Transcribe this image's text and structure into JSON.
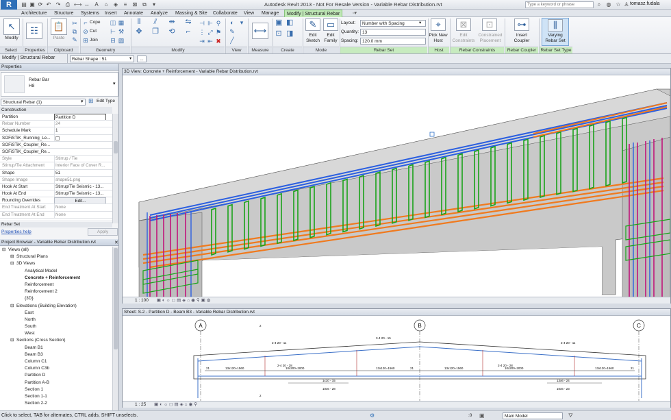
{
  "app": {
    "logo_letter": "R",
    "title": "Autodesk Revit 2013 - Not For Resale Version -   Variable Rebar Distribution.rvt",
    "search_placeholder": "Type a keyword or phrase",
    "user": "tomasz.fudala"
  },
  "ribbon_tabs": [
    "Architecture",
    "Structure",
    "Systems",
    "Insert",
    "Annotate",
    "Analyze",
    "Massing & Site",
    "Collaborate",
    "View",
    "Manage",
    "Modify | Structural Rebar"
  ],
  "ribbon": {
    "select": {
      "modify": "Modify",
      "panel": "Select"
    },
    "properties": {
      "panel": "Properties"
    },
    "clipboard": {
      "paste": "Paste",
      "panel": "Clipboard"
    },
    "geometry": {
      "cope": "Cope",
      "cut": "Cut",
      "join": "Join",
      "panel": "Geometry"
    },
    "modify": {
      "panel": "Modify"
    },
    "view": {
      "panel": "View"
    },
    "measure": {
      "panel": "Measure"
    },
    "create": {
      "panel": "Create"
    },
    "mode": {
      "edit_sketch_1": "Edit",
      "edit_sketch_2": "Sketch",
      "edit_family_1": "Edit",
      "edit_family_2": "Family",
      "panel": "Mode"
    },
    "rebar_set": {
      "layout_label": "Layout:",
      "layout_value": "Number with Spacing",
      "quantity_label": "Quantity:",
      "quantity_value": "13",
      "spacing_label": "Spacing:",
      "spacing_value": "120.0 mm",
      "panel": "Rebar Set"
    },
    "host": {
      "pick_1": "Pick New",
      "pick_2": "Host",
      "panel": "Host"
    },
    "constraints": {
      "edit_1": "Edit",
      "edit_2": "Constraints",
      "constrained_1": "Constrained",
      "constrained_2": "Placement",
      "panel": "Rebar Constraints"
    },
    "coupler": {
      "insert_1": "Insert",
      "insert_2": "Coupler",
      "panel": "Rebar Coupler"
    },
    "settype": {
      "varying_1": "Varying",
      "varying_2": "Rebar Set",
      "panel": "Rebar Set Type"
    }
  },
  "optionsbar": {
    "context": "Modify | Structural Rebar",
    "shape_label": "Rebar Shape : 51"
  },
  "properties": {
    "header": "Properties",
    "type_name": "Rebar Bar",
    "type_sub": "H8",
    "instance_filter": "Structural Rebar (1)",
    "edit_type": "Edit Type",
    "group": "Construction",
    "rows": [
      {
        "name": "Partition",
        "value": "Partition D"
      },
      {
        "name": "Rebar Number",
        "value": "24"
      },
      {
        "name": "Schedule Mark",
        "value": "1"
      },
      {
        "name": "SOFiSTiK_Running_Le...",
        "value": ""
      },
      {
        "name": "SOFiSTiK_Coupler_Re...",
        "value": ""
      },
      {
        "name": "SOFiSTiK_Coupler_Re...",
        "value": ""
      },
      {
        "name": "Style",
        "value": "Stirrup / Tie"
      },
      {
        "name": "Stirrup/Tie Attachment",
        "value": "Interior Face of Cover R..."
      },
      {
        "name": "Shape",
        "value": "51"
      },
      {
        "name": "Shape Image",
        "value": "shape51.png"
      },
      {
        "name": "Hook At Start",
        "value": "Stirrup/Tie Seismic - 13..."
      },
      {
        "name": "Hook At End",
        "value": "Stirrup/Tie Seismic - 13..."
      },
      {
        "name": "Rounding Overrides",
        "value": "Edit..."
      },
      {
        "name": "End Treatment At Start",
        "value": "None"
      },
      {
        "name": "End Treatment At End",
        "value": "None"
      }
    ],
    "next_group": "Rebar Set",
    "help_link": "Properties help",
    "apply": "Apply"
  },
  "browser": {
    "header": "Project Browser - Variable Rebar Distribution.rvt",
    "nodes": [
      {
        "label": "Views (all)",
        "indent": 0,
        "toggle": "−",
        "bold": false
      },
      {
        "label": "Structural Plans",
        "indent": 1,
        "toggle": "+",
        "bold": false
      },
      {
        "label": "3D Views",
        "indent": 1,
        "toggle": "−",
        "bold": false
      },
      {
        "label": "Analytical Model",
        "indent": 2,
        "toggle": "",
        "bold": false
      },
      {
        "label": "Concrete + Reinforcement",
        "indent": 2,
        "toggle": "",
        "bold": true
      },
      {
        "label": "Reinforcement",
        "indent": 2,
        "toggle": "",
        "bold": false
      },
      {
        "label": "Reinforcement 2",
        "indent": 2,
        "toggle": "",
        "bold": false
      },
      {
        "label": "{3D}",
        "indent": 2,
        "toggle": "",
        "bold": false
      },
      {
        "label": "Elevations (Building Elevation)",
        "indent": 1,
        "toggle": "−",
        "bold": false
      },
      {
        "label": "East",
        "indent": 2,
        "toggle": "",
        "bold": false
      },
      {
        "label": "North",
        "indent": 2,
        "toggle": "",
        "bold": false
      },
      {
        "label": "South",
        "indent": 2,
        "toggle": "",
        "bold": false
      },
      {
        "label": "West",
        "indent": 2,
        "toggle": "",
        "bold": false
      },
      {
        "label": "Sections (Cross Section)",
        "indent": 1,
        "toggle": "−",
        "bold": false
      },
      {
        "label": "Beam B1",
        "indent": 2,
        "toggle": "",
        "bold": false
      },
      {
        "label": "Beam B3",
        "indent": 2,
        "toggle": "",
        "bold": false
      },
      {
        "label": "Column C1",
        "indent": 2,
        "toggle": "",
        "bold": false
      },
      {
        "label": "Column C3b",
        "indent": 2,
        "toggle": "",
        "bold": false
      },
      {
        "label": "Partition D",
        "indent": 2,
        "toggle": "",
        "bold": false
      },
      {
        "label": "Partition A-B",
        "indent": 2,
        "toggle": "",
        "bold": false
      },
      {
        "label": "Section 1",
        "indent": 2,
        "toggle": "",
        "bold": false
      },
      {
        "label": "Section 1-1",
        "indent": 2,
        "toggle": "",
        "bold": false
      },
      {
        "label": "Section 2-2",
        "indent": 2,
        "toggle": "",
        "bold": false
      }
    ]
  },
  "view3d": {
    "title": "3D View: Concrete + Reinforcement - Variable Rebar Distribution.rvt",
    "scale": "1 : 100"
  },
  "sheet": {
    "title": "Sheet: S.2 - Partition D - Beam B3 - Variable Rebar Distribution.rvt",
    "scale": "1 : 25",
    "grid_a": "A",
    "grid_b": "B",
    "grid_c": "C",
    "tag_top_left": "2",
    "tag_left_bar": "2-4 20 - 11",
    "tag_mid_bar": "3-4 20 - 15",
    "tag_right_bar": "2-4 20 - 11",
    "dim1": "13x120=1560",
    "dim2": "10x200=2000",
    "dim3": "13x120=1560",
    "dim4": "13x120=1560",
    "dim5": "10x200=2000",
    "dim6": "13x120=1560",
    "sec_left": "2-4 20 - 28",
    "sec_right": "2-4 20 - 28",
    "stir_l1": "1x10 - 15",
    "stir_l2": "10x6 - 28",
    "stir_r1": "13x6 - 24",
    "stir_r2": "10x6 - 23",
    "num_21a": "21",
    "num_21b": "21",
    "num_21c": "21",
    "tag_bottom": "2"
  },
  "status": {
    "text": "Click to select, TAB for alternates, CTRL adds, SHIFT unselects.",
    "zoom": ":0",
    "model": "Main Model"
  },
  "colors": {
    "stirrup": "#1aa31a",
    "top_bar": "#2b5fe0",
    "bottom_bar": "#f07a1e",
    "column_bar": "#c0147a"
  }
}
